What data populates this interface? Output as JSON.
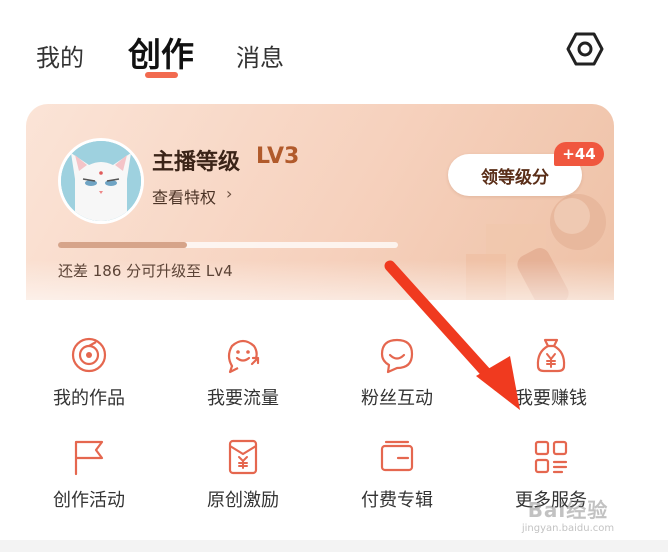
{
  "tabs": {
    "mine": "我的",
    "create": "创作",
    "messages": "消息"
  },
  "level_card": {
    "title": "主播等级",
    "level": "LV3",
    "privileges_link": "查看特权",
    "claim_button": "领等级分",
    "claim_count": "+44",
    "progress_text": "还差 186 分可升级至 Lv4",
    "progress_fraction": 0.38
  },
  "grid": [
    {
      "label": "我的作品",
      "icon": "disc-icon"
    },
    {
      "label": "我要流量",
      "icon": "traffic-face-icon"
    },
    {
      "label": "粉丝互动",
      "icon": "chat-smile-icon"
    },
    {
      "label": "我要赚钱",
      "icon": "money-bag-icon"
    },
    {
      "label": "创作活动",
      "icon": "flag-icon"
    },
    {
      "label": "原创激励",
      "icon": "reward-envelope-icon"
    },
    {
      "label": "付费专辑",
      "icon": "wallet-album-icon"
    },
    {
      "label": "更多服务",
      "icon": "more-services-grid-icon"
    }
  ],
  "watermark": {
    "logo": "Bai经验",
    "url": "jingyan.baidu.com"
  },
  "colors": {
    "accent": "#f26a4f",
    "icon_stroke": "#e5674f",
    "arrow": "#f03a1f",
    "card_gradient_start": "#fbe4d7",
    "card_gradient_end": "#eec1a6"
  }
}
